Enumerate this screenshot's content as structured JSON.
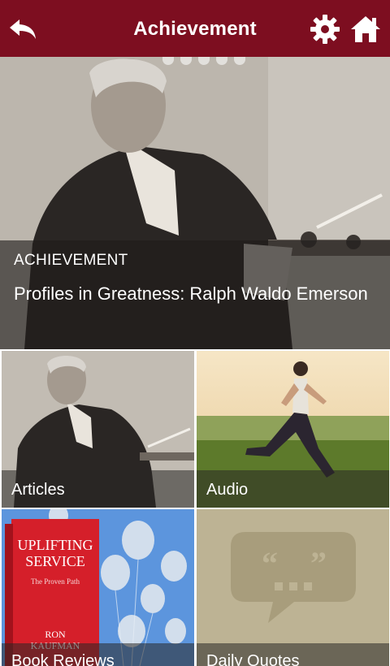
{
  "header": {
    "title": "Achievement",
    "back_icon": "back-arrow-icon",
    "settings_icon": "gear-icon",
    "home_icon": "home-icon",
    "background": "#7d0e20"
  },
  "hero": {
    "kicker": "ACHIEVEMENT",
    "headline": "Profiles in Greatness: Ralph Waldo Emerson"
  },
  "tiles": [
    {
      "label": "Articles"
    },
    {
      "label": "Audio"
    },
    {
      "label": "Book Reviews",
      "book_title": "UPLIFTING SERVICE",
      "book_subtitle": "The Proven Path",
      "book_author": "RON KAUFMAN"
    },
    {
      "label": "Daily Quotes",
      "icon": "quote-bubble-icon"
    }
  ]
}
